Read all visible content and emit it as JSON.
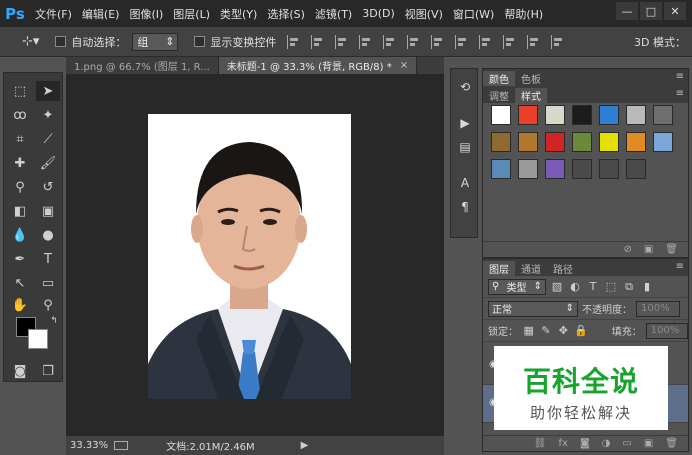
{
  "app": {
    "logo": "Ps"
  },
  "menu": [
    "文件(F)",
    "编辑(E)",
    "图像(I)",
    "图层(L)",
    "类型(Y)",
    "选择(S)",
    "滤镜(T)",
    "3D(D)",
    "视图(V)",
    "窗口(W)",
    "帮助(H)"
  ],
  "options": {
    "auto_select_label": "自动选择：",
    "auto_select_value": "组",
    "show_transform_label": "显示变换控件",
    "mode3d_label": "3D 模式："
  },
  "doc_tabs": [
    {
      "label": "1.png @ 66.7% (图层 1, R..."
    },
    {
      "label": "未标题-1 @ 33.3% (背景, RGB/8) *",
      "close": "×"
    }
  ],
  "status": {
    "zoom": "33.33%",
    "doc": "文档:2.01M/2.46M",
    "arrow": "▶"
  },
  "swatches_panel": {
    "tabs": [
      "颜色",
      "色板"
    ]
  },
  "styles_panel": {
    "tabs": [
      "调整",
      "样式"
    ],
    "styles": [
      "#ffffff",
      "#e8402a",
      "#d8d8c8",
      "#1c1c1c",
      "#2f7fd6",
      "#b9b9b9",
      "#6e6e6e",
      "#8f6a30",
      "#b0782e",
      "#cf2525",
      "#6a8a3a",
      "#e4e000",
      "#e28a24",
      "#7aa6d8",
      "#5a8ab8",
      "#9a9a9a",
      "#7a5cb8",
      "#4a4a4a",
      "#4a4a4a",
      "#4a4a4a"
    ]
  },
  "layers_panel": {
    "tabs": [
      "图层",
      "通道",
      "路径"
    ],
    "filter_kind": "类型",
    "blend_mode": "正常",
    "opacity_label": "不透明度：",
    "opacity_value": "100%",
    "lock_label": "锁定：",
    "fill_label": "填充：",
    "fill_value": "100%"
  },
  "watermark": {
    "title": "百科全说",
    "subtitle": "助你轻松解决"
  }
}
